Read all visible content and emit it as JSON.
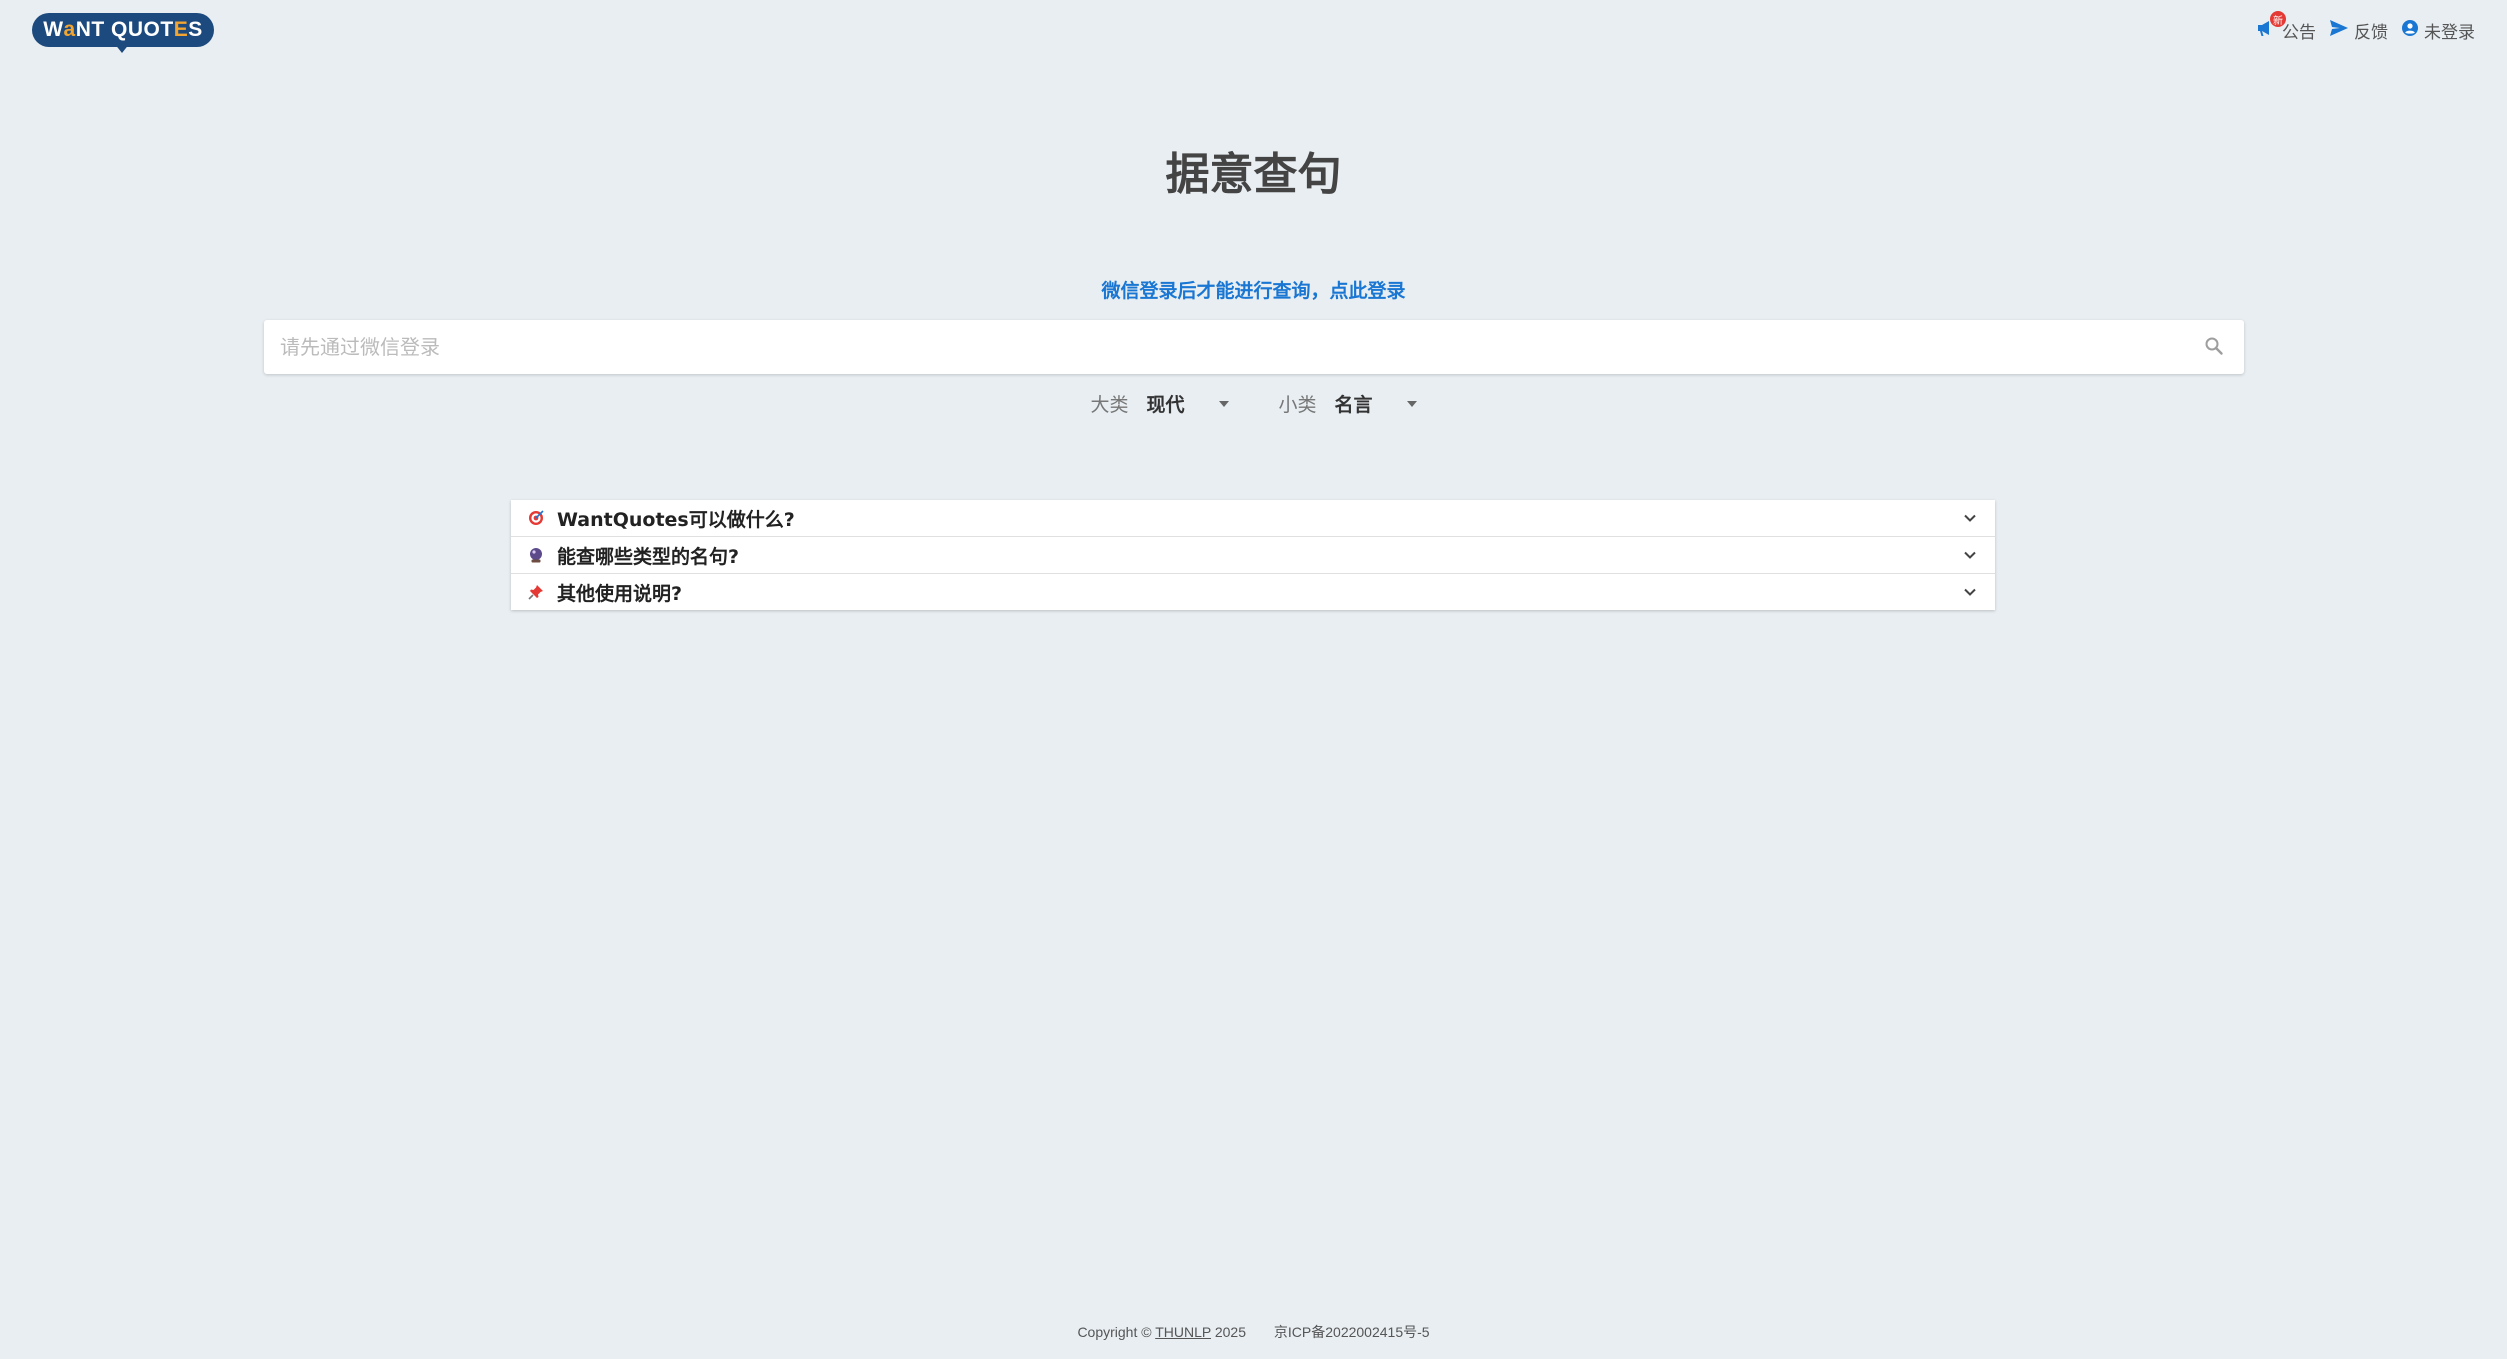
{
  "header": {
    "logo": {
      "pre": "W",
      "accent1": "a",
      "mid": "NT QUOT",
      "accent2": "E",
      "post": "S"
    },
    "nav": {
      "announce_label": "公告",
      "announce_badge": "新",
      "feedback_label": "反馈",
      "login_label": "未登录"
    }
  },
  "main": {
    "title": "据意查句",
    "login_hint": "微信登录后才能进行查询，点此登录",
    "search": {
      "placeholder": "请先通过微信登录",
      "value": ""
    },
    "filters": {
      "category_label": "大类",
      "category_value": "现代",
      "subcategory_label": "小类",
      "subcategory_value": "名言"
    }
  },
  "faq": [
    {
      "title": "WantQuotes可以做什么?",
      "icon": "target-icon"
    },
    {
      "title": "能查哪些类型的名句?",
      "icon": "crystal-ball-icon"
    },
    {
      "title": "其他使用说明?",
      "icon": "pushpin-icon"
    }
  ],
  "footer": {
    "copyright_prefix": "Copyright ©",
    "org": "THUNLP",
    "year": "2025",
    "icp": "京ICP备2022002415号-5"
  },
  "colors": {
    "background": "#e8eef2",
    "brand": "#1d4a7e",
    "accent": "#f2a531",
    "link": "#1976d2",
    "badge": "#e53935"
  }
}
